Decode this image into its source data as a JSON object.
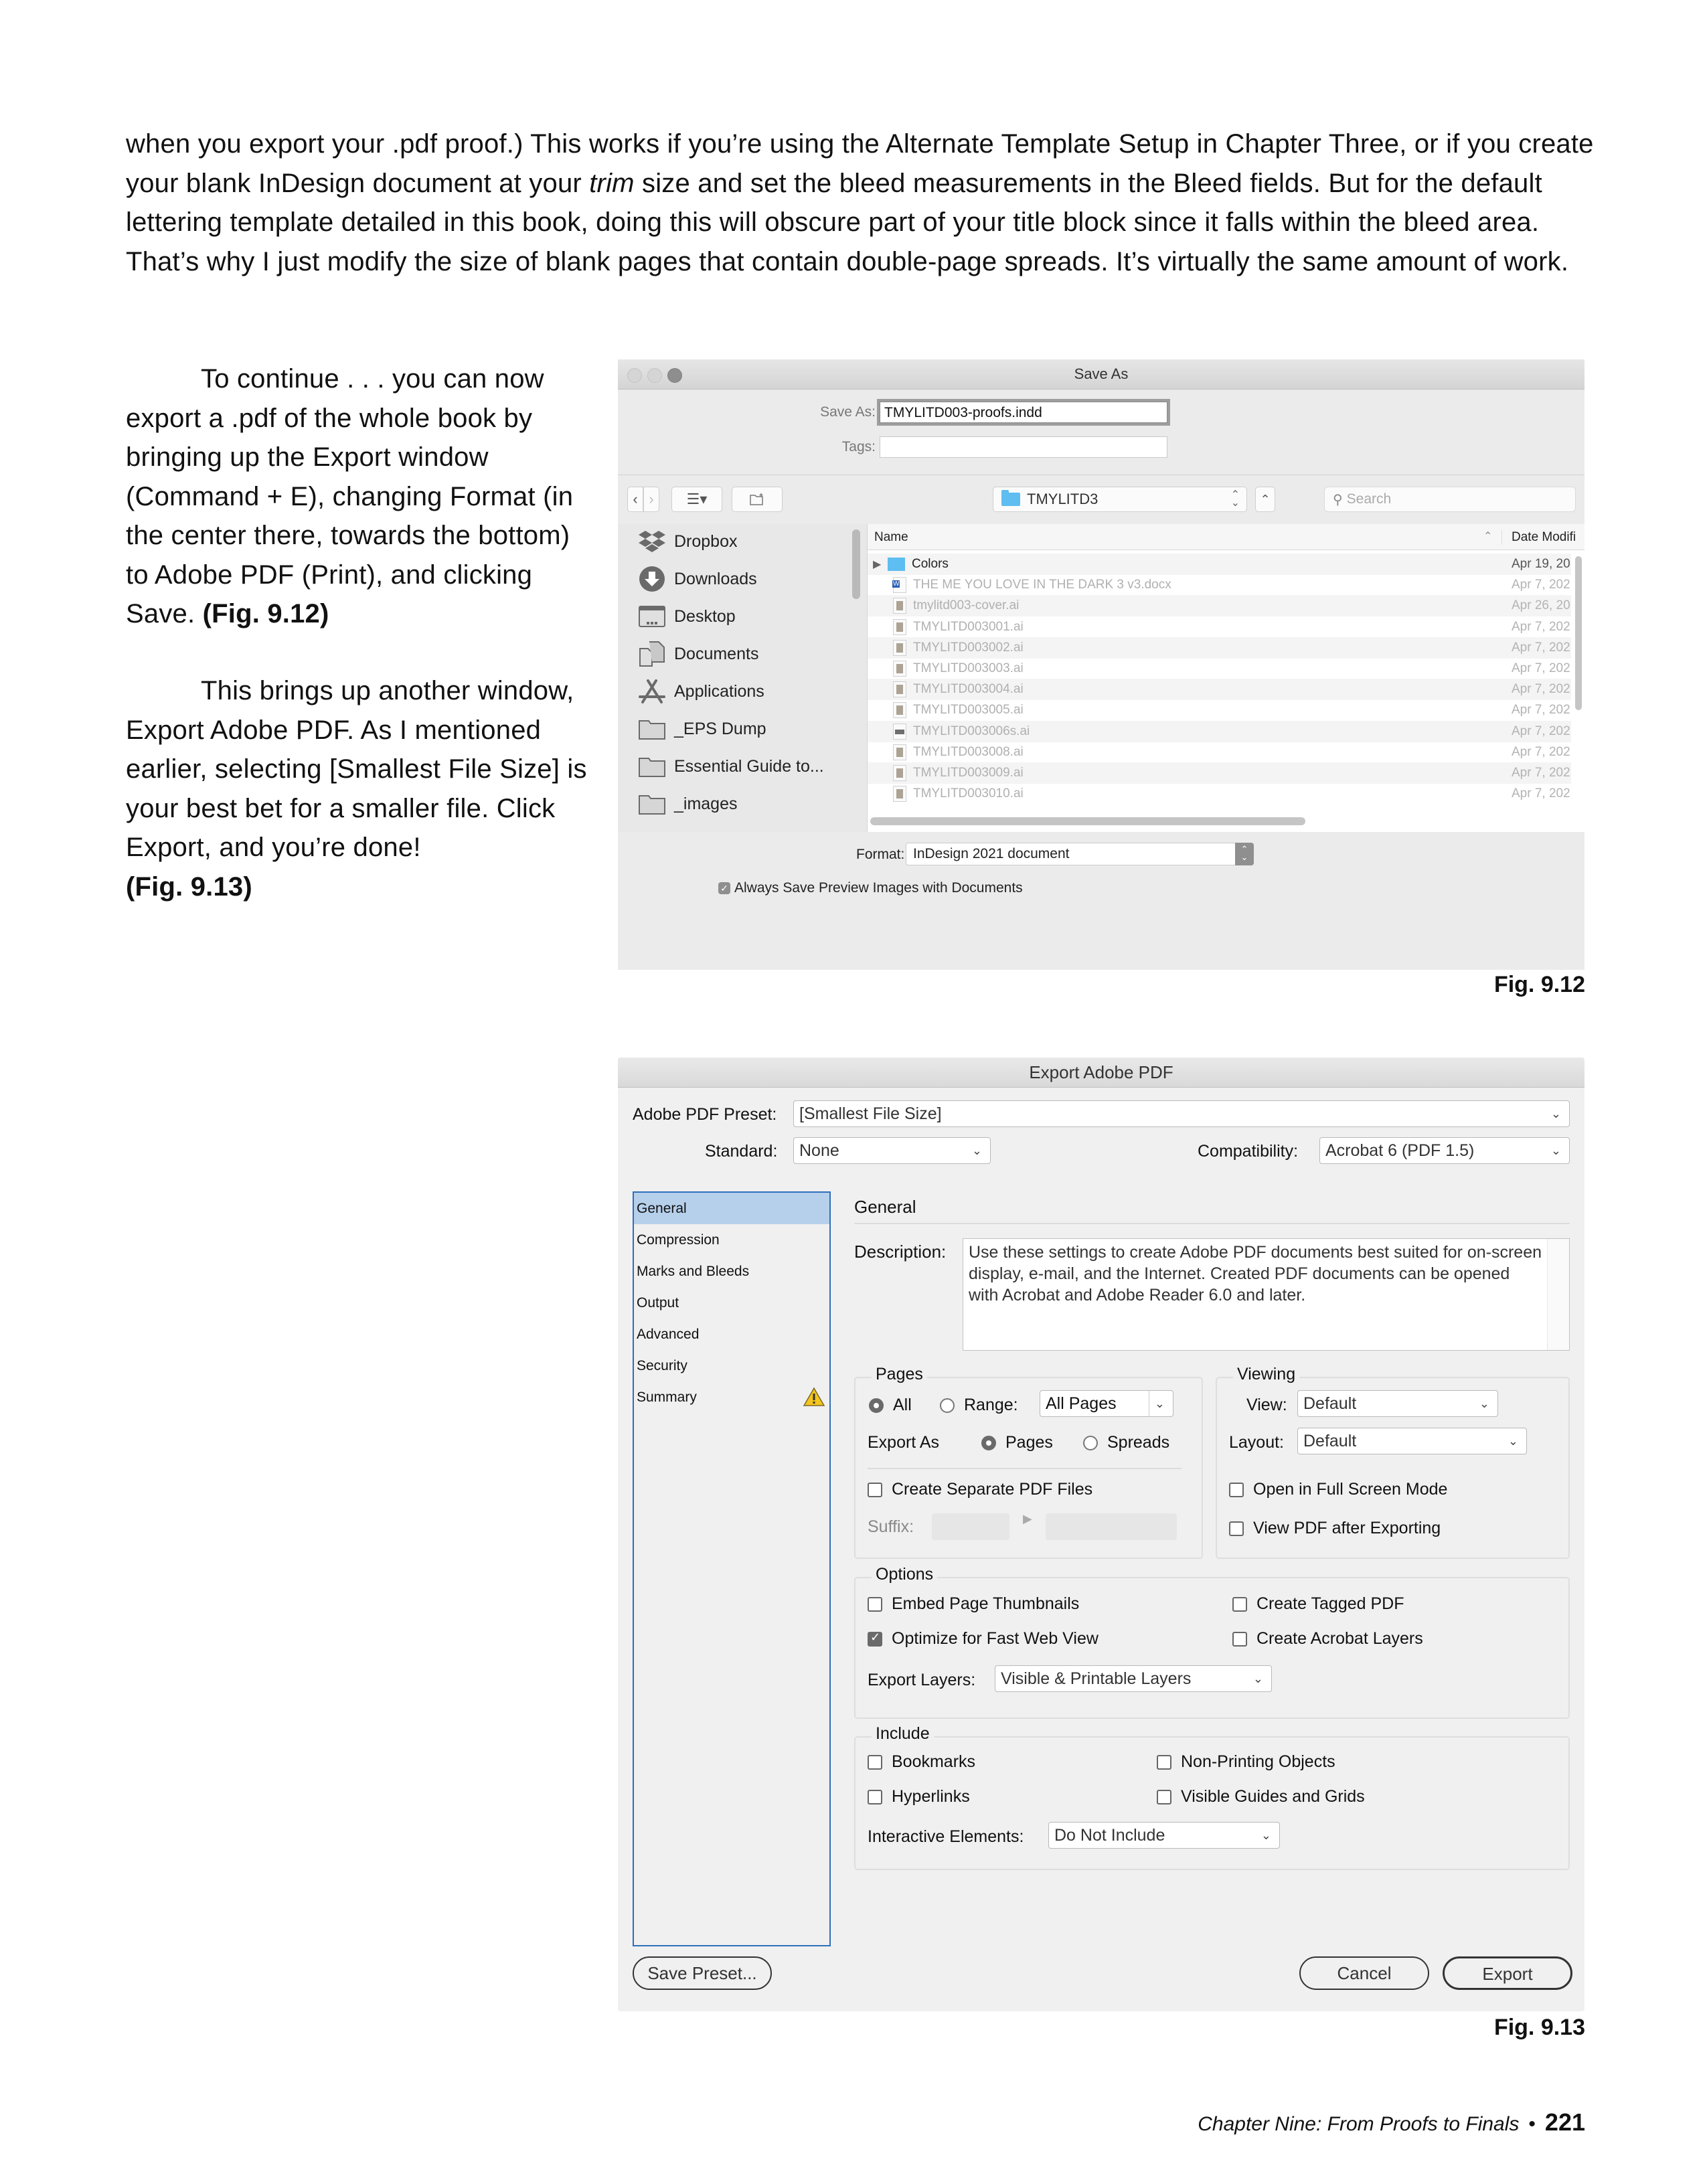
{
  "body": {
    "intro_segments": [
      {
        "text": "when you export your .pdf proof.) This works if you’re using the Alternate Template Setup in Chapter Three, or if you create your blank InDesign document at your ",
        "style": "normal"
      },
      {
        "text": "trim",
        "style": "italic"
      },
      {
        "text": " size and set the bleed measurements in the Bleed fields. But for the default lettering template detailed in this book, doing this will obscure part of your title block since it falls within the bleed area. That’s why I just modify the size of blank pages that contain double-page spreads. It’s virtually the same amount of work.",
        "style": "normal"
      }
    ],
    "para_continue": "To continue . . . you can now export a .pdf of the whole book by bringing up the Export window (Command + E), changing Format (in the center there, towards the bottom) to Adobe PDF (Print), and clicking Save.",
    "para_continue_ref": "(Fig. 9.12)",
    "para_another": "This brings up another window, Export Adobe PDF. As I mentioned earlier, selecting [Smallest File Size] is your best bet for a smaller file. Click Export, and you’re done!",
    "para_another_ref": "(Fig. 9.13)"
  },
  "figure_912": {
    "caption": "Fig. 9.12",
    "dialog": {
      "title": "Save As",
      "save_as_label": "Save As:",
      "save_as_value": "TMYLITD003-proofs.indd",
      "tags_label": "Tags:",
      "tags_value": "",
      "location": "TMYLITD3",
      "search_placeholder": "Search",
      "sidebar": [
        {
          "label": "Dropbox",
          "icon": "dropbox-icon"
        },
        {
          "label": "Downloads",
          "icon": "downloads-icon"
        },
        {
          "label": "Desktop",
          "icon": "desktop-icon"
        },
        {
          "label": "Documents",
          "icon": "documents-icon"
        },
        {
          "label": "Applications",
          "icon": "applications-icon"
        },
        {
          "label": "_EPS Dump",
          "icon": "folder-icon"
        },
        {
          "label": "Essential Guide to...",
          "icon": "folder-icon"
        },
        {
          "label": "_images",
          "icon": "folder-icon"
        }
      ],
      "columns": {
        "name": "Name",
        "date": "Date Modifi"
      },
      "files": [
        {
          "name": "Colors",
          "date": "Apr 19, 20",
          "type": "folder"
        },
        {
          "name": "THE ME YOU LOVE IN THE DARK 3 v3.docx",
          "date": "Apr 7, 202",
          "type": "word"
        },
        {
          "name": "tmylitd003-cover.ai",
          "date": "Apr 26, 20",
          "type": "art"
        },
        {
          "name": "TMYLITD003001.ai",
          "date": "Apr 7, 202",
          "type": "art"
        },
        {
          "name": "TMYLITD003002.ai",
          "date": "Apr 7, 202",
          "type": "art"
        },
        {
          "name": "TMYLITD003003.ai",
          "date": "Apr 7, 202",
          "type": "art"
        },
        {
          "name": "TMYLITD003004.ai",
          "date": "Apr 7, 202",
          "type": "art"
        },
        {
          "name": "TMYLITD003005.ai",
          "date": "Apr 7, 202",
          "type": "art"
        },
        {
          "name": "TMYLITD003006s.ai",
          "date": "Apr 7, 202",
          "type": "wide"
        },
        {
          "name": "TMYLITD003008.ai",
          "date": "Apr 7, 202",
          "type": "art"
        },
        {
          "name": "TMYLITD003009.ai",
          "date": "Apr 7, 202",
          "type": "art"
        },
        {
          "name": "TMYLITD003010.ai",
          "date": "Apr 7, 202",
          "type": "art"
        }
      ],
      "format_label": "Format:",
      "format_value": "InDesign 2021 document",
      "preview_checkbox_label": "Always Save Preview Images with Documents",
      "preview_checked": true
    }
  },
  "figure_913": {
    "caption": "Fig. 9.13",
    "dialog": {
      "title": "Export Adobe PDF",
      "preset_label": "Adobe PDF Preset:",
      "preset_value": "[Smallest File Size]",
      "standard_label": "Standard:",
      "standard_value": "None",
      "compatibility_label": "Compatibility:",
      "compatibility_value": "Acrobat 6 (PDF 1.5)",
      "panels": [
        "General",
        "Compression",
        "Marks and Bleeds",
        "Output",
        "Advanced",
        "Security",
        "Summary"
      ],
      "selected_panel": "General",
      "section_title": "General",
      "description_label": "Description:",
      "description": "Use these settings to create Adobe PDF documents best suited for on-screen display, e-mail, and the Internet.  Created PDF documents can be opened with Acrobat and Adobe Reader 6.0 and later.",
      "pages": {
        "title": "Pages",
        "all_label": "All",
        "range_label": "Range:",
        "range_value": "All Pages",
        "export_as_label": "Export As",
        "pages_label": "Pages",
        "spreads_label": "Spreads",
        "separate_label": "Create Separate PDF Files",
        "suffix_label": "Suffix:"
      },
      "viewing": {
        "title": "Viewing",
        "view_label": "View:",
        "view_value": "Default",
        "layout_label": "Layout:",
        "layout_value": "Default",
        "fullscreen_label": "Open in Full Screen Mode",
        "view_after_label": "View PDF after Exporting"
      },
      "options": {
        "title": "Options",
        "embed_thumbs": "Embed Page Thumbnails",
        "tagged_pdf": "Create Tagged PDF",
        "fast_web": "Optimize for Fast Web View",
        "acrobat_layers": "Create Acrobat Layers",
        "export_layers_label": "Export Layers:",
        "export_layers_value": "Visible & Printable Layers"
      },
      "include": {
        "title": "Include",
        "bookmarks": "Bookmarks",
        "non_printing": "Non-Printing Objects",
        "hyperlinks": "Hyperlinks",
        "guides_grids": "Visible Guides and Grids",
        "interactive_label": "Interactive Elements:",
        "interactive_value": "Do Not Include"
      },
      "save_preset_button": "Save Preset...",
      "cancel_button": "Cancel",
      "export_button": "Export"
    }
  },
  "footer": {
    "chapter": "Chapter Nine: From Proofs to Finals",
    "bullet": "•",
    "page_number": "221"
  }
}
